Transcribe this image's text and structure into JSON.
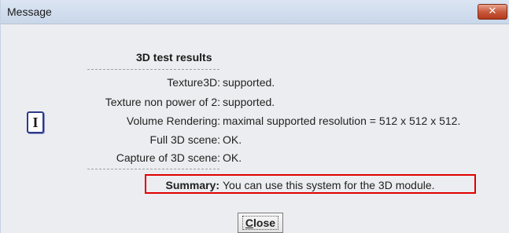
{
  "window": {
    "title": "Message"
  },
  "dialog": {
    "heading": "3D test results",
    "rows": [
      {
        "label": "Texture3D:",
        "value": "supported."
      },
      {
        "label": "Texture non power of 2:",
        "value": "supported."
      },
      {
        "label": "Volume Rendering:",
        "value": "maximal supported resolution = 512 x 512 x 512."
      },
      {
        "label": "Full 3D scene:",
        "value": "OK."
      },
      {
        "label": "Capture of 3D scene:",
        "value": "OK."
      }
    ],
    "summary": {
      "label": "Summary:",
      "value": "You can use this system for the 3D module."
    },
    "close_button": {
      "mnemonic": "C",
      "rest": "lose"
    }
  },
  "icons": {
    "titlebar_close": "close-icon",
    "message_type": "info-icon"
  },
  "colors": {
    "highlight_border": "#e00000",
    "titlebar_close_bg": "#c85a3c"
  }
}
